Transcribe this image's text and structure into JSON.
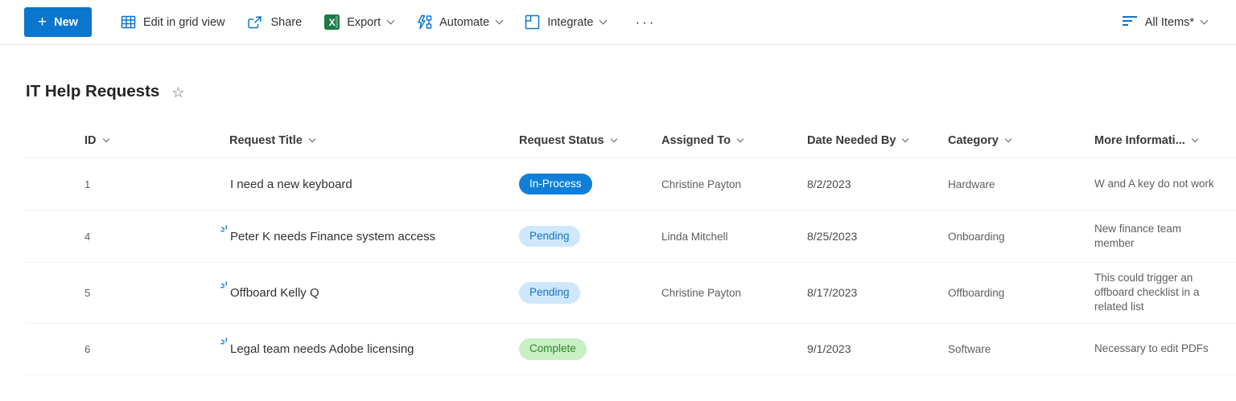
{
  "colors": {
    "accent": "#0b76ce",
    "excel_green": "#1a7c44",
    "new_spark": "#2b88d8",
    "badge_in_process_bg": "#0f7fd9",
    "badge_in_process_text": "#ffffff",
    "badge_pending_bg": "#cfe7fb",
    "badge_pending_text": "#0b76ce",
    "badge_complete_bg": "#c9efc5",
    "badge_complete_text": "#2d882d"
  },
  "toolbar": {
    "new_label": "New",
    "new_plus": "+",
    "edit_grid_label": "Edit in grid view",
    "share_label": "Share",
    "export_label": "Export",
    "export_icon_letter": "X",
    "automate_label": "Automate",
    "integrate_label": "Integrate",
    "more_label": "···",
    "view_selector_label": "All Items*"
  },
  "page": {
    "title": "IT Help Requests",
    "star_icon": "☆"
  },
  "table": {
    "columns": [
      "ID",
      "Request Title",
      "Request Status",
      "Assigned To",
      "Date Needed By",
      "Category",
      "More Informati..."
    ],
    "rows": [
      {
        "id": "1",
        "new_indicator": false,
        "title": "I need a new keyboard",
        "status": {
          "label": "In-Process",
          "variant": "in-process"
        },
        "assigned_to": "Christine Payton",
        "date_needed": "8/2/2023",
        "category": "Hardware",
        "more_info": "W and A key do not work"
      },
      {
        "id": "4",
        "new_indicator": true,
        "title": "Peter K needs Finance system access",
        "status": {
          "label": "Pending",
          "variant": "pending"
        },
        "assigned_to": "Linda Mitchell",
        "date_needed": "8/25/2023",
        "category": "Onboarding",
        "more_info": "New finance team member"
      },
      {
        "id": "5",
        "new_indicator": true,
        "title": "Offboard Kelly Q",
        "status": {
          "label": "Pending",
          "variant": "pending"
        },
        "assigned_to": "Christine Payton",
        "date_needed": "8/17/2023",
        "category": "Offboarding",
        "more_info": "This could trigger an offboard checklist in a related list"
      },
      {
        "id": "6",
        "new_indicator": true,
        "title": "Legal team needs Adobe licensing",
        "status": {
          "label": "Complete",
          "variant": "complete"
        },
        "assigned_to": "",
        "date_needed": "9/1/2023",
        "category": "Software",
        "more_info": "Necessary to edit PDFs"
      }
    ]
  }
}
